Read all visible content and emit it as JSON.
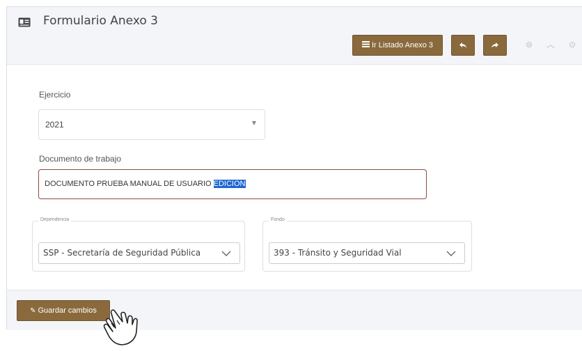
{
  "header": {
    "title": "Formulario Anexo 3",
    "list_button_label": "Ir Listado Anexo 3",
    "list_button_icon": "list-icon",
    "undo_icon": "undo-icon",
    "redo_icon": "redo-icon"
  },
  "form": {
    "ejercicio": {
      "label": "Ejercicio",
      "value": "2021"
    },
    "documento": {
      "label": "Documento de trabajo",
      "value_prefix": "DOCUMENTO PRUEBA MANUAL DE USUARIO ",
      "value_selected": "EDICION"
    },
    "dependencia": {
      "legend": "Dependencia",
      "value": "SSP - Secretaría de Seguridad Pública"
    },
    "fondo": {
      "legend": "Fondo",
      "value": "393 - Tránsito y Seguridad Vial"
    }
  },
  "footer": {
    "save_label": "Guardar cambios",
    "save_icon": "edit-icon"
  },
  "colors": {
    "button": "#8a6a3c",
    "input_focus_border": "#8c4c42",
    "text_selection": "#1e66d0",
    "header_bg": "#f3f5f8"
  }
}
